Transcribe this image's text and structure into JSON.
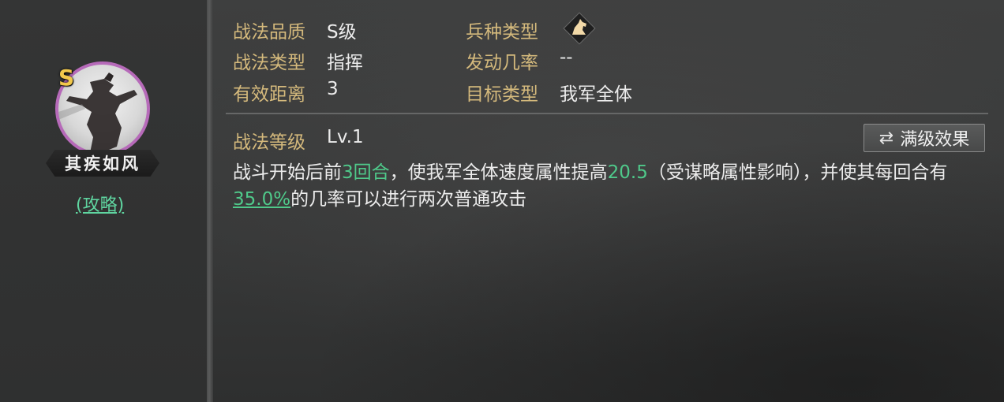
{
  "skill": {
    "grade_badge": "S",
    "name": "其疾如风",
    "guide_link": "(攻略)"
  },
  "info": {
    "quality_label": "战法品质",
    "quality_value": "S级",
    "type_label": "战法类型",
    "type_value": "指挥",
    "range_label": "有效距离",
    "range_value": "3",
    "troop_label": "兵种类型",
    "troop_icon": "horse-cavalry-icon",
    "rate_label": "发动几率",
    "rate_value": "--",
    "target_label": "目标类型",
    "target_value": "我军全体",
    "level_label": "战法等级",
    "level_value": "Lv.1"
  },
  "max_button": {
    "label": "满级效果",
    "icon": "swap-arrows-icon"
  },
  "description": {
    "part1": "战斗开始后前",
    "hl1": "3回合",
    "part2": "，使我军全体速度属性提高",
    "hl2": "20.5",
    "part3": "（受谋略属性影响），并使其每回合有",
    "hl3": "35.0%",
    "part4": "的几率可以进行两次普通攻击"
  },
  "colors": {
    "label": "#d4b97c",
    "highlight": "#4fc98a",
    "portrait_border": "#b66ab9",
    "grade": "#f2c84b"
  }
}
